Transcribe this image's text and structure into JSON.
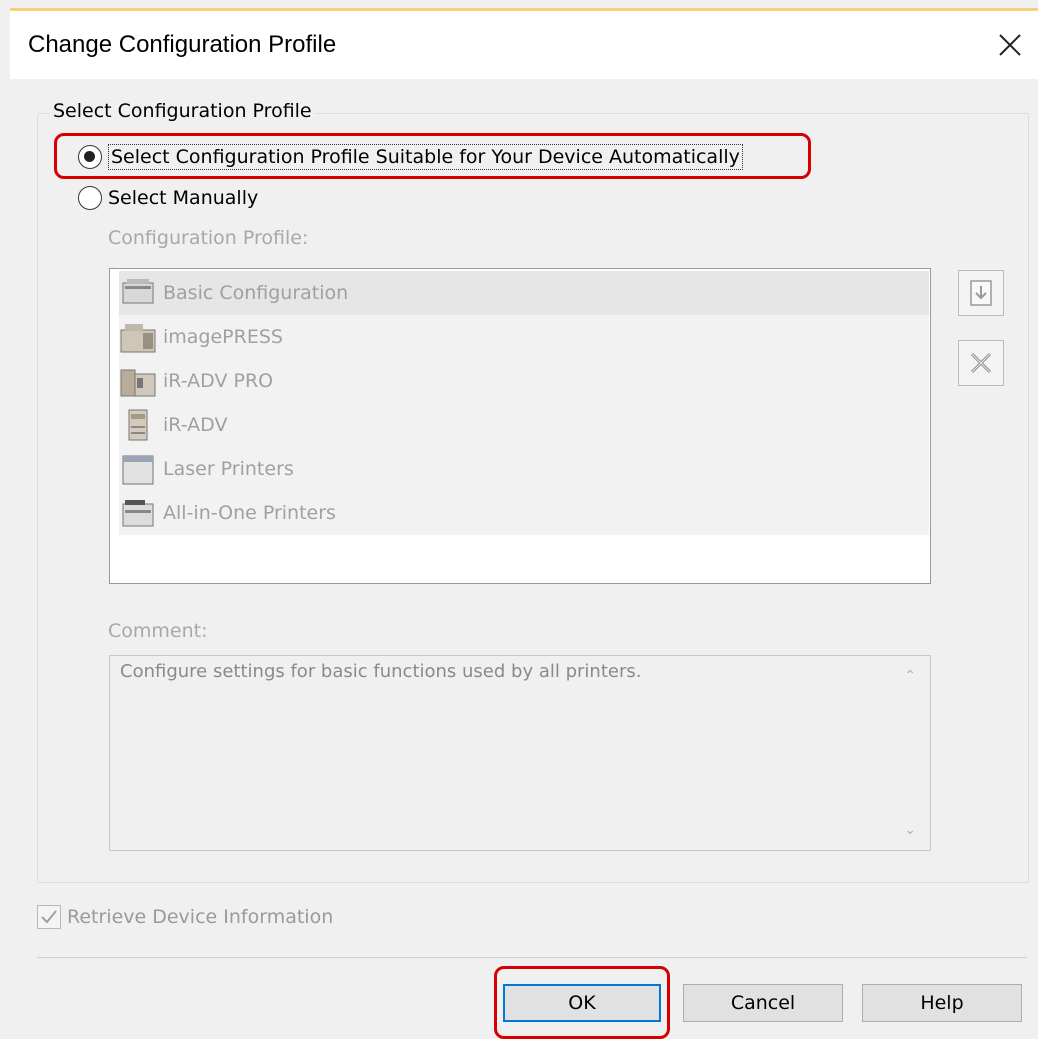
{
  "window": {
    "title": "Change Configuration Profile"
  },
  "group": {
    "label": "Select Configuration Profile"
  },
  "options": {
    "auto": {
      "label": "Select Configuration Profile Suitable for Your Device Automatically",
      "checked": true
    },
    "manual": {
      "label": "Select Manually",
      "checked": false
    }
  },
  "profiles": {
    "label": "Configuration Profile:",
    "items": [
      {
        "label": "Basic Configuration",
        "icon": "printer-basic-icon"
      },
      {
        "label": "imagePRESS",
        "icon": "production-printer-icon"
      },
      {
        "label": "iR-ADV PRO",
        "icon": "production-printer-icon"
      },
      {
        "label": "iR-ADV",
        "icon": "office-printer-icon"
      },
      {
        "label": "Laser Printers",
        "icon": "laser-printer-icon"
      },
      {
        "label": "All-in-One Printers",
        "icon": "all-in-one-printer-icon"
      }
    ]
  },
  "comment": {
    "label": "Comment:",
    "text": "Configure settings for basic functions used by all printers."
  },
  "retrieve": {
    "label": "Retrieve Device Information",
    "checked": true
  },
  "buttons": {
    "ok": "OK",
    "cancel": "Cancel",
    "help": "Help"
  }
}
